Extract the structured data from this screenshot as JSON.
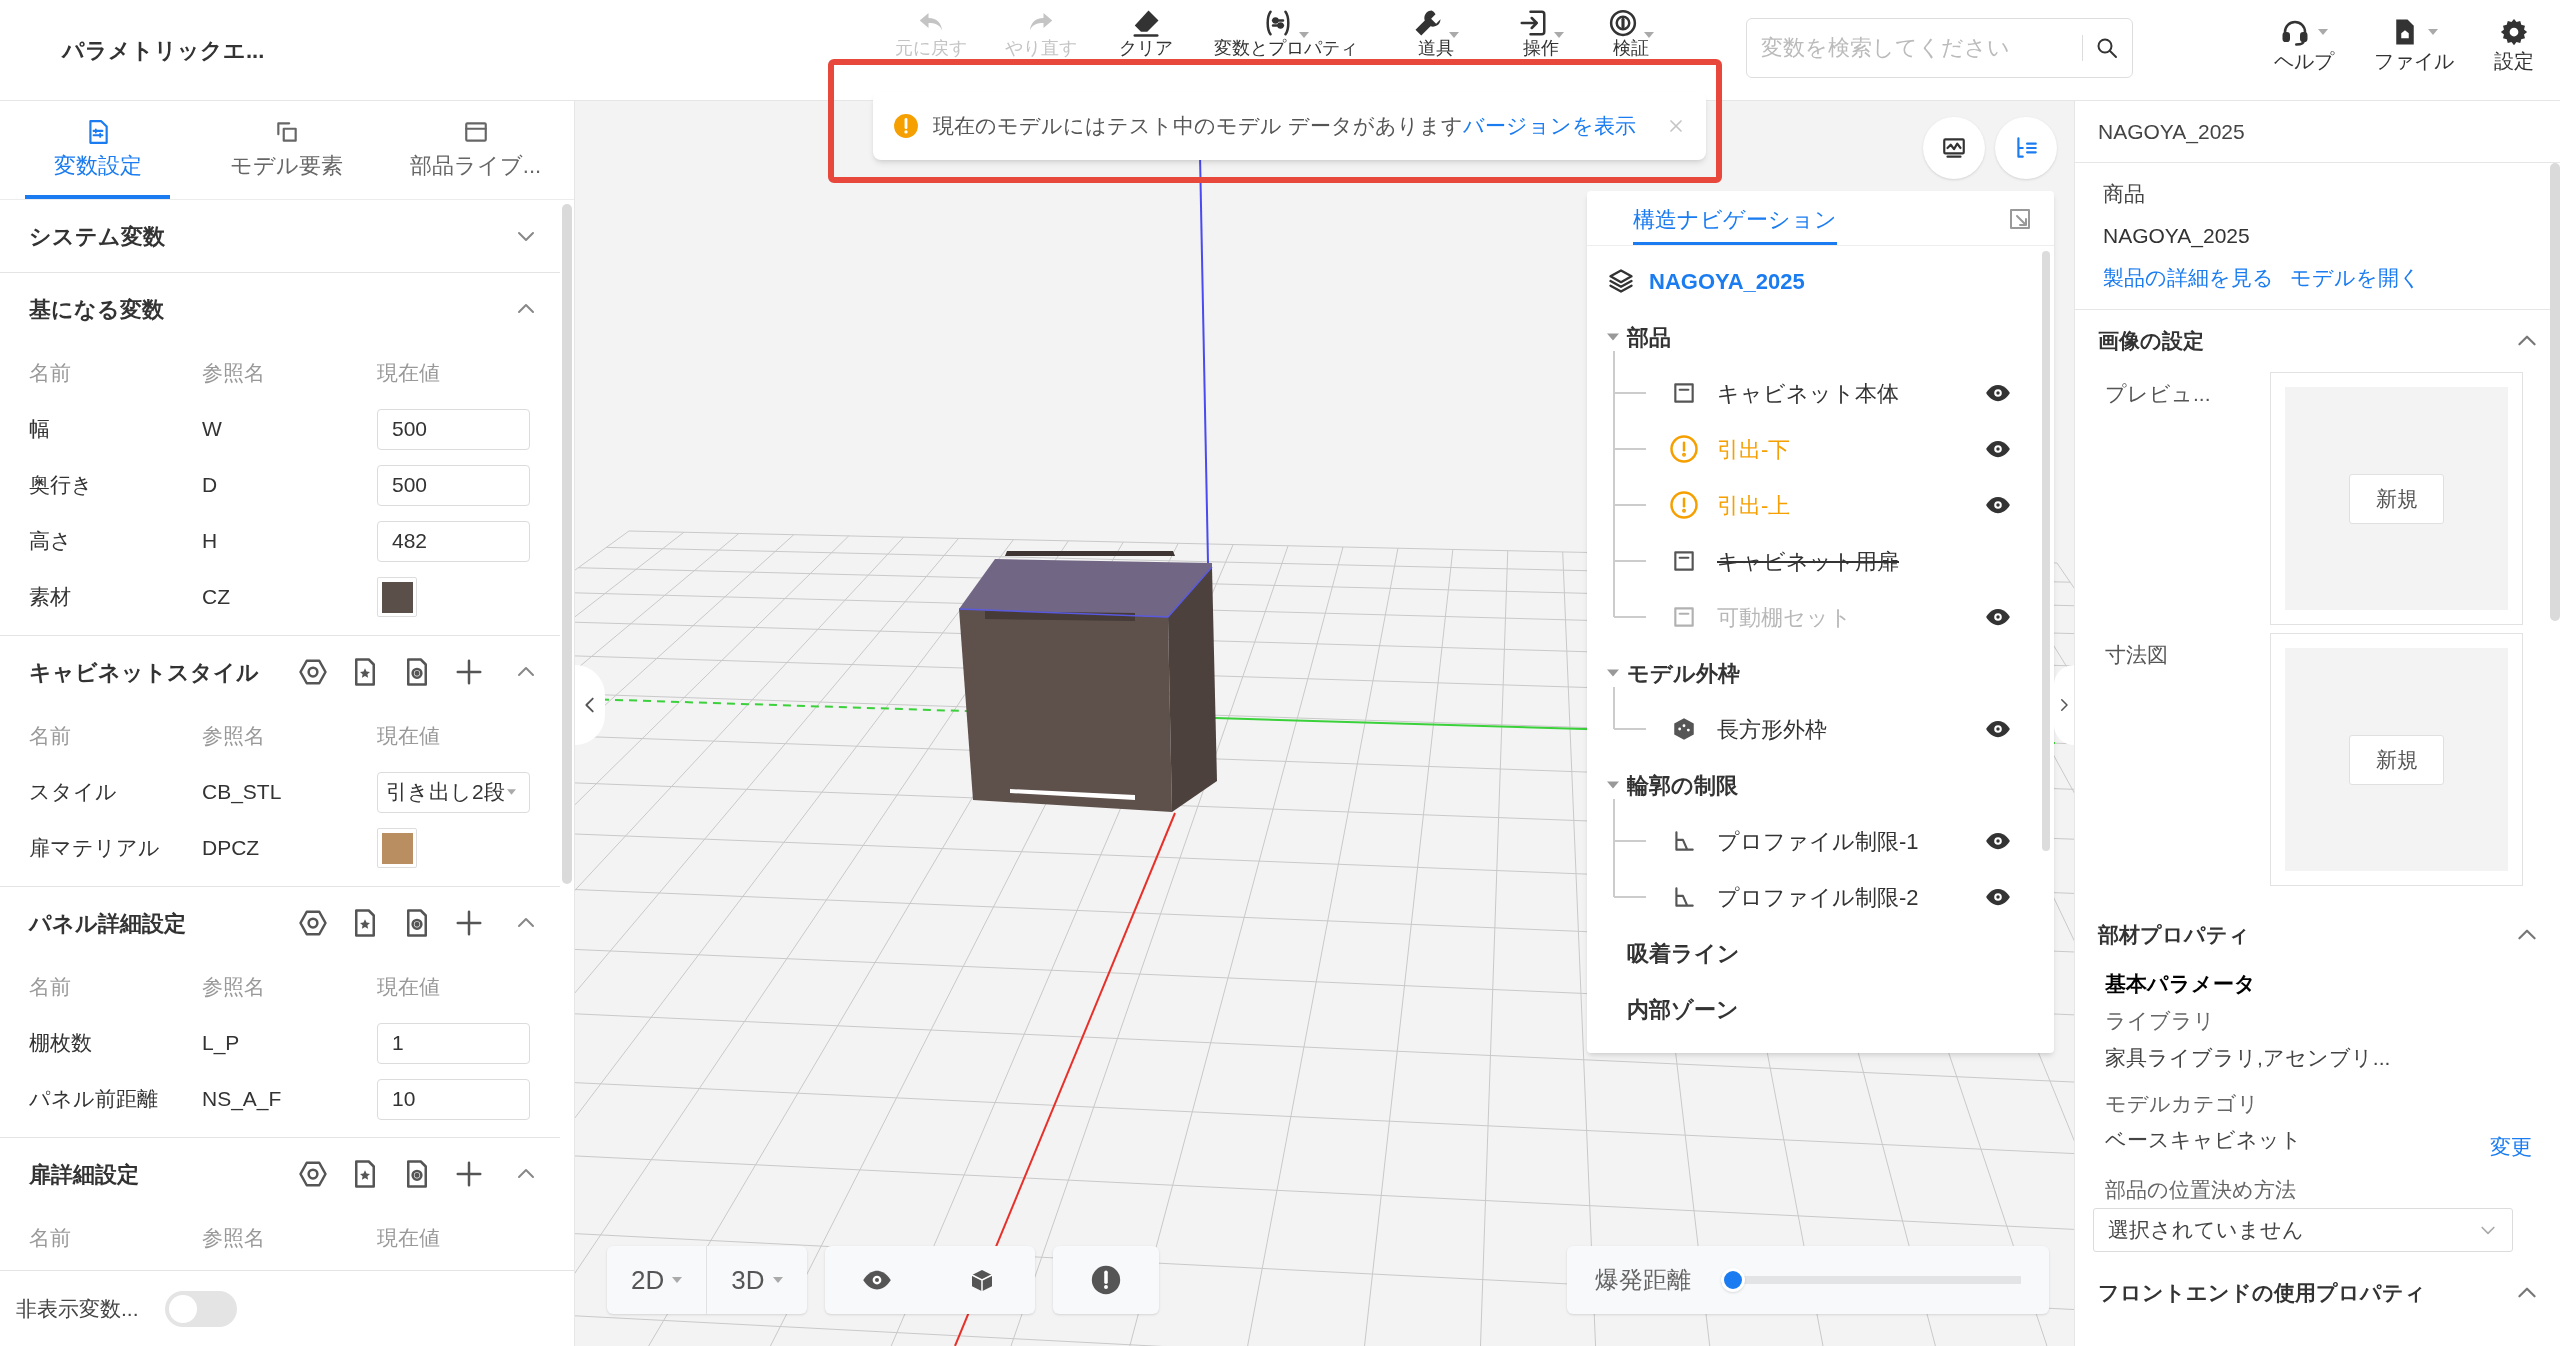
{
  "app_title": "パラメトリックエ...",
  "toolbar": [
    {
      "label": "元に戻す",
      "disabled": true,
      "has_menu": false
    },
    {
      "label": "やり直す",
      "disabled": true,
      "has_menu": false
    },
    {
      "label": "クリア",
      "disabled": false,
      "has_menu": false
    },
    {
      "label": "変数とプロパティ",
      "disabled": false,
      "has_menu": true
    },
    {
      "label": "道具",
      "disabled": false,
      "has_menu": true
    },
    {
      "label": "操作",
      "disabled": false,
      "has_menu": true
    },
    {
      "label": "検証",
      "disabled": false,
      "has_menu": true
    }
  ],
  "search": {
    "placeholder": "変数を検索してください"
  },
  "header_actions": [
    {
      "label": "ヘルプ",
      "has_menu": true
    },
    {
      "label": "ファイル",
      "has_menu": true
    },
    {
      "label": "設定",
      "has_menu": false
    }
  ],
  "notice": {
    "message": "現在のモデルにはテスト中のモデル データがあります",
    "link": "バージョンを表示",
    "highlighted": true
  },
  "left_tabs": [
    {
      "label": "変数設定",
      "selected": true
    },
    {
      "label": "モデル要素",
      "selected": false
    },
    {
      "label": "部品ライブ...",
      "selected": false
    }
  ],
  "variable_sections": [
    {
      "title": "システム変数",
      "expanded": false,
      "tools": false
    },
    {
      "title": "基になる変数",
      "expanded": true,
      "tools": false,
      "columns": [
        "名前",
        "参照名",
        "現在値"
      ],
      "rows": [
        {
          "name": "幅",
          "ref": "W",
          "kind": "input",
          "value": "500"
        },
        {
          "name": "奥行き",
          "ref": "D",
          "kind": "input",
          "value": "500"
        },
        {
          "name": "高さ",
          "ref": "H",
          "kind": "input",
          "value": "482"
        },
        {
          "name": "素材",
          "ref": "CZ",
          "kind": "swatch",
          "color": "#5b4f4a"
        }
      ]
    },
    {
      "title": "キャビネットスタイル",
      "expanded": true,
      "tools": true,
      "columns": [
        "名前",
        "参照名",
        "現在値"
      ],
      "rows": [
        {
          "name": "スタイル",
          "ref": "CB_STL",
          "kind": "select",
          "value": "引き出し2段"
        },
        {
          "name": "扉マテリアル",
          "ref": "DPCZ",
          "kind": "swatch",
          "color": "#b98f62"
        }
      ]
    },
    {
      "title": "パネル詳細設定",
      "expanded": true,
      "tools": true,
      "columns": [
        "名前",
        "参照名",
        "現在値"
      ],
      "rows": [
        {
          "name": "棚枚数",
          "ref": "L_P",
          "kind": "input",
          "value": "1"
        },
        {
          "name": "パネル前距離",
          "ref": "NS_A_F",
          "kind": "input",
          "value": "10"
        }
      ]
    },
    {
      "title": "扉詳細設定",
      "expanded": true,
      "tools": true,
      "columns": [
        "名前",
        "参照名",
        "現在値"
      ]
    }
  ],
  "hidden_variables": {
    "label": "非表示変数...",
    "on": false
  },
  "structure_nav": {
    "tab": "構造ナビゲーション",
    "root": "NAGOYA_2025",
    "groups": [
      {
        "label": "部品",
        "expanded": true,
        "children": [
          {
            "label": "キャビネット本体",
            "kind": "part",
            "warning": false,
            "excluded": false,
            "dimmed": false,
            "visible": true
          },
          {
            "label": "引出-下",
            "kind": "warning",
            "warning": true,
            "excluded": false,
            "dimmed": false,
            "visible": true
          },
          {
            "label": "引出-上",
            "kind": "warning",
            "warning": true,
            "excluded": false,
            "dimmed": false,
            "visible": true
          },
          {
            "label": "キャビネット用扉",
            "kind": "part",
            "warning": false,
            "excluded": true,
            "dimmed": false,
            "visible": false
          },
          {
            "label": "可動棚セット",
            "kind": "part",
            "warning": false,
            "excluded": false,
            "dimmed": true,
            "visible": true
          }
        ]
      },
      {
        "label": "モデル外枠",
        "expanded": true,
        "children": [
          {
            "label": "長方形外枠",
            "kind": "frame",
            "warning": false,
            "excluded": false,
            "dimmed": false,
            "visible": true
          }
        ]
      },
      {
        "label": "輪郭の制限",
        "expanded": true,
        "children": [
          {
            "label": "プロファイル制限-1",
            "kind": "profile",
            "warning": false,
            "excluded": false,
            "dimmed": false,
            "visible": true
          },
          {
            "label": "プロファイル制限-2",
            "kind": "profile",
            "warning": false,
            "excluded": false,
            "dimmed": false,
            "visible": true
          }
        ]
      },
      {
        "label": "吸着ライン"
      },
      {
        "label": "内部ゾーン"
      }
    ]
  },
  "view_controls": {
    "modes": [
      "2D",
      "3D"
    ],
    "explode": {
      "label": "爆発距離",
      "level": 0
    }
  },
  "properties_panel": {
    "title": "NAGOYA_2025",
    "product": {
      "label": "商品",
      "value": "NAGOYA_2025",
      "links": [
        "製品の詳細を見る",
        "モデルを開く"
      ]
    },
    "image_settings": {
      "title": "画像の設定",
      "expanded": true,
      "items": [
        {
          "label": "プレビュ...",
          "button": "新規"
        },
        {
          "label": "寸法図",
          "button": "新規"
        }
      ]
    },
    "member_properties": {
      "title": "部材プロパティ",
      "expanded": true,
      "subtitle": "基本パラメータ",
      "library": {
        "label": "ライブラリ",
        "value": "家具ライブラリ,アセンブリ..."
      },
      "category": {
        "label": "モデルカテゴリ",
        "value": "ベースキャビネット",
        "action": "変更"
      },
      "positioning": {
        "label": "部品の位置決め方法",
        "value": "選択されていません"
      }
    },
    "frontend": {
      "title": "フロントエンドの使用プロパティ",
      "expanded": true
    }
  }
}
